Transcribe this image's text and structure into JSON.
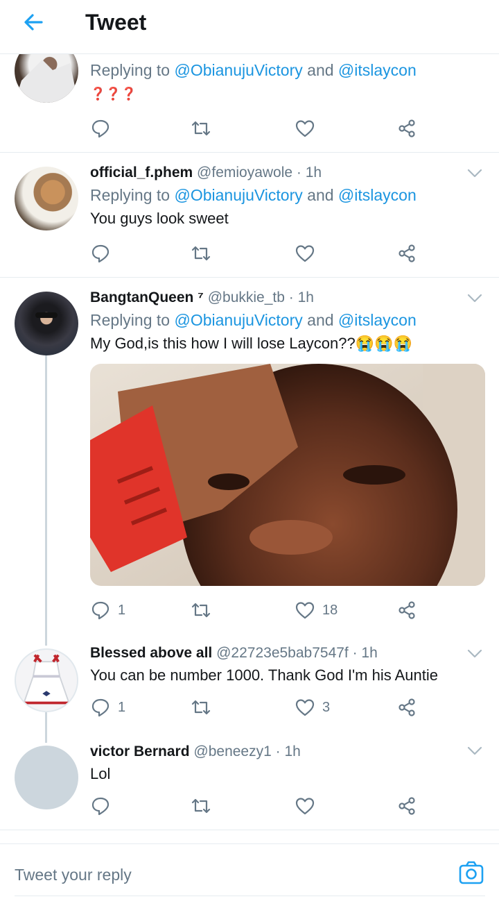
{
  "header": {
    "title": "Tweet"
  },
  "tweets": [
    {
      "name": "",
      "handle": "",
      "replying_prefix": "Replying to ",
      "replying_user1": "@ObianujuVictory",
      "replying_and": " and ",
      "replying_user2": "@itslaycon",
      "text": "❓❓❓",
      "reply_count": "",
      "like_count": ""
    },
    {
      "name": "official_f.phem",
      "handle": "@femioyawole · 1h",
      "replying_prefix": "Replying to ",
      "replying_user1": "@ObianujuVictory",
      "replying_and": " and ",
      "replying_user2": "@itslaycon",
      "text": "You guys look sweet",
      "reply_count": "",
      "like_count": ""
    },
    {
      "name": "BangtanQueen ⁷",
      "handle": "@bukkie_tb · 1h",
      "replying_prefix": "Replying to ",
      "replying_user1": "@ObianujuVictory",
      "replying_and": " and ",
      "replying_user2": "@itslaycon",
      "text": "My God,is this how I will lose Laycon??😭😭😭",
      "reply_count": "1",
      "like_count": "18"
    },
    {
      "name": "Blessed above all",
      "handle": "@22723e5bab7547f · 1h",
      "text": "You can be number 1000. Thank God I'm his Auntie",
      "reply_count": "1",
      "like_count": "3"
    },
    {
      "name": "victor Bernard",
      "handle": "@beneezy1 · 1h",
      "text": "Lol",
      "reply_count": "",
      "like_count": ""
    }
  ],
  "composer": {
    "placeholder": "Tweet your reply"
  },
  "colors": {
    "accent": "#1da1f2",
    "link": "#1b95e0",
    "muted": "#657786",
    "divider": "#e6ecf0"
  },
  "icons": [
    "back-arrow-icon",
    "reply-icon",
    "retweet-icon",
    "like-icon",
    "share-icon",
    "chevron-down-icon",
    "camera-icon"
  ]
}
